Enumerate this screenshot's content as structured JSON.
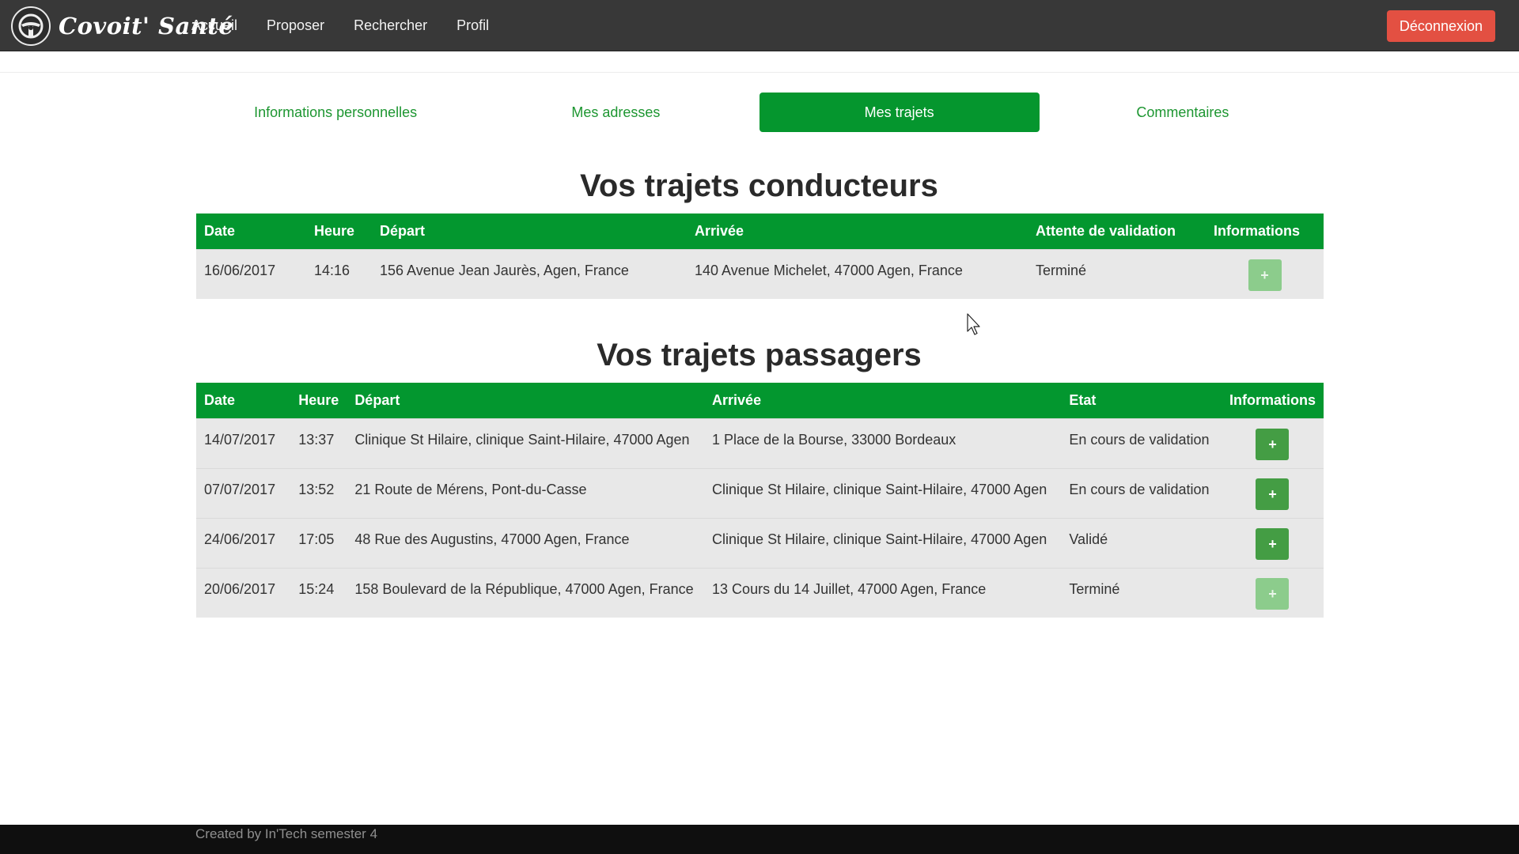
{
  "navbar": {
    "logo_icon": "steering-wheel-icon",
    "brand": "Covoit' Santé",
    "links": [
      "Accueil",
      "Proposer",
      "Rechercher",
      "Profil"
    ],
    "logout_label": "Déconnexion",
    "logout_color": "#e35042"
  },
  "tabs": {
    "items": [
      "Informations personnelles",
      "Mes adresses",
      "Mes trajets",
      "Commentaires"
    ],
    "active": "Mes trajets",
    "accent_color": "#05962e"
  },
  "driver_section": {
    "title": "Vos trajets conducteurs",
    "columns": [
      "Date",
      "Heure",
      "Départ",
      "Arrivée",
      "Attente de validation",
      "Informations"
    ],
    "rows": [
      {
        "date": "16/06/2017",
        "time": "14:16",
        "departure": "156 Avenue Jean Jaurès, Agen, France",
        "arrival": "140 Avenue Michelet, 47000 Agen, France",
        "status": "Terminé",
        "button": "+",
        "button_disabled": true
      }
    ]
  },
  "passenger_section": {
    "title": "Vos trajets passagers",
    "columns": [
      "Date",
      "Heure",
      "Départ",
      "Arrivée",
      "Etat",
      "Informations"
    ],
    "rows": [
      {
        "date": "14/07/2017",
        "time": "13:37",
        "departure": "Clinique St Hilaire, clinique Saint-Hilaire, 47000 Agen",
        "arrival": "1 Place de la Bourse, 33000 Bordeaux",
        "status": "En cours de validation",
        "button": "+",
        "button_disabled": false
      },
      {
        "date": "07/07/2017",
        "time": "13:52",
        "departure": "21 Route de Mérens, Pont-du-Casse",
        "arrival": "Clinique St Hilaire, clinique Saint-Hilaire, 47000 Agen",
        "status": "En cours de validation",
        "button": "+",
        "button_disabled": false
      },
      {
        "date": "24/06/2017",
        "time": "17:05",
        "departure": "48 Rue des Augustins, 47000 Agen, France",
        "arrival": "Clinique St Hilaire, clinique Saint-Hilaire, 47000 Agen",
        "status": "Validé",
        "button": "+",
        "button_disabled": false
      },
      {
        "date": "20/06/2017",
        "time": "15:24",
        "departure": "158 Boulevard de la République, 47000 Agen, France",
        "arrival": "13 Cours du 14 Juillet, 47000 Agen, France",
        "status": "Terminé",
        "button": "+",
        "button_disabled": true
      }
    ]
  },
  "footer": {
    "text": "Created by In'Tech semester 4"
  }
}
